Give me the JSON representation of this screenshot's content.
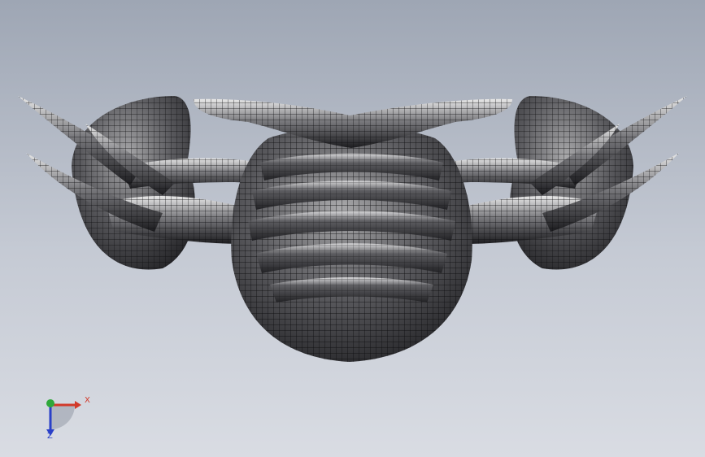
{
  "viewport": {
    "background_top": "#9ea6b4",
    "background_bottom": "#d9dce3",
    "model": {
      "icon": "creature-mesh-model",
      "render_style": "shaded-with-edges",
      "body_color": "#55555a",
      "edge_color": "#101012"
    }
  },
  "triad": {
    "x_label": "X",
    "z_label": "Z",
    "x_color": "#d23a2a",
    "y_color": "#2fa83a",
    "z_color": "#2a40c8"
  }
}
